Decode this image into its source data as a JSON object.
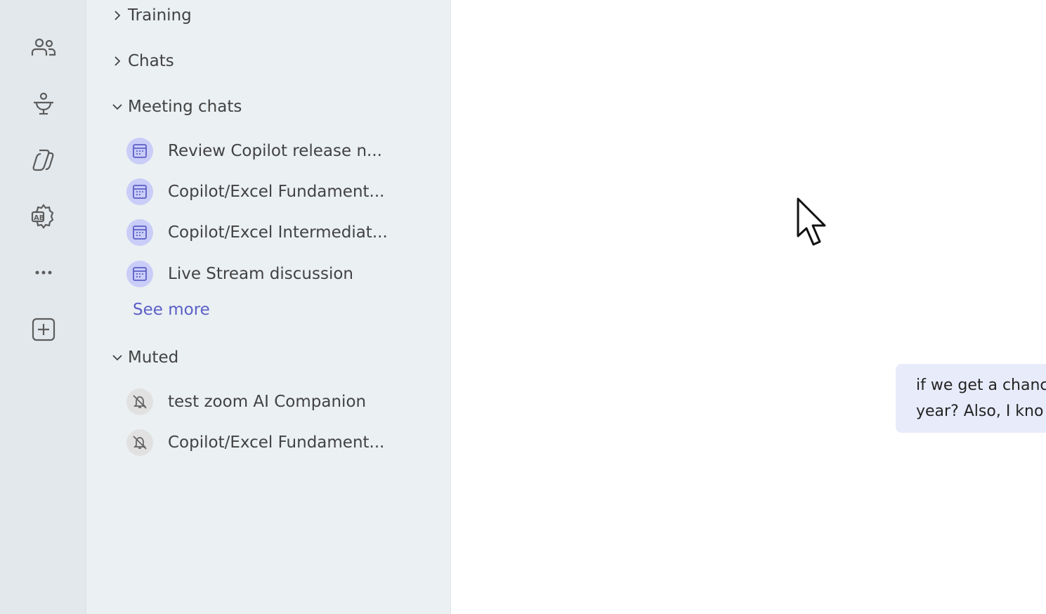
{
  "rail": {
    "items": [
      {
        "name": "people-icon"
      },
      {
        "name": "learning-icon"
      },
      {
        "name": "copilot-icon"
      },
      {
        "name": "translator-settings-icon"
      },
      {
        "name": "more-icon"
      },
      {
        "name": "add-apps-icon"
      }
    ]
  },
  "sections": {
    "training": {
      "label": "Training",
      "expanded": false
    },
    "chats": {
      "label": "Chats",
      "expanded": false
    },
    "meeting_chats": {
      "label": "Meeting chats",
      "expanded": true,
      "items": [
        {
          "title": "Review Copilot release n..."
        },
        {
          "title": "Copilot/Excel Fundament..."
        },
        {
          "title": "Copilot/Excel Intermediat..."
        },
        {
          "title": "Live Stream discussion"
        }
      ],
      "see_more": "See more"
    },
    "muted": {
      "label": "Muted",
      "expanded": true,
      "items": [
        {
          "title": "test zoom AI Companion"
        },
        {
          "title": "Copilot/Excel Fundament..."
        }
      ]
    }
  },
  "message": {
    "line1": "if we get a chanc",
    "line2": "year? Also, I kno"
  },
  "colors": {
    "accent": "#5b5fc7",
    "bubble": "#e8ebfa",
    "meeting_avatar": "#c9cdf7"
  }
}
